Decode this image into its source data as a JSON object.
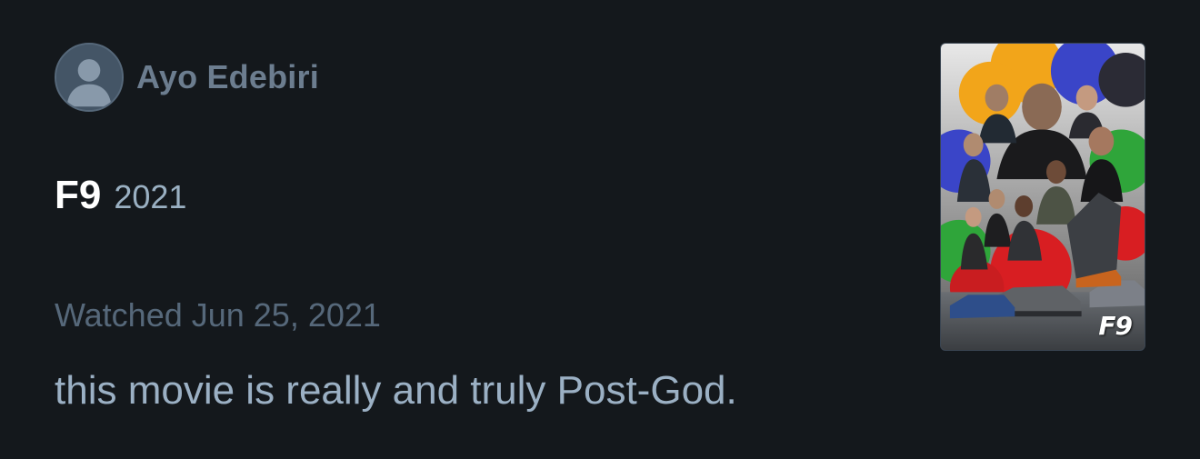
{
  "review": {
    "author": {
      "name": "Ayo Edebiri",
      "avatar_icon": "person-silhouette-icon"
    },
    "film": {
      "title": "F9",
      "year": "2021",
      "poster_logo": "F9"
    },
    "watched_label": "Watched Jun 25, 2021",
    "text": "this movie is really and truly Post-God."
  },
  "colors": {
    "background": "#14181c",
    "author_name": "#6c7d8f",
    "title": "#ffffff",
    "year": "#9ab0c2",
    "watched": "#56687a",
    "review_text": "#9bb0c4"
  }
}
